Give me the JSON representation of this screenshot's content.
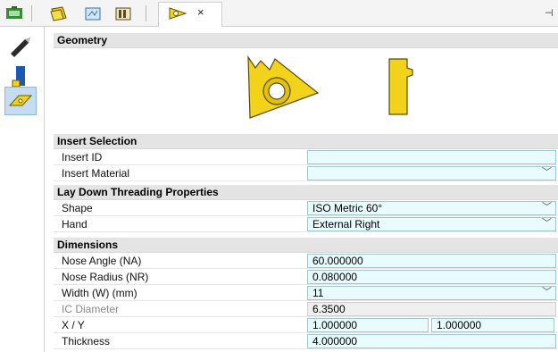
{
  "toolbar": {
    "tabs": [
      {
        "icon": "tool-holder-icon"
      },
      {
        "icon": "insert-stack-icon"
      },
      {
        "icon": "drawing-icon"
      },
      {
        "icon": "library-icon"
      },
      {
        "icon": "threading-insert-icon",
        "active": true
      }
    ],
    "close_label": "×",
    "pin_label": "⊣"
  },
  "leftbar": {
    "items": [
      {
        "icon": "tool-tip-icon"
      },
      {
        "icon": "holder-icon"
      },
      {
        "icon": "insert-icon",
        "active": true
      }
    ]
  },
  "sections": {
    "geometry": {
      "title": "Geometry"
    },
    "insert_selection": {
      "title": "Insert Selection",
      "insert_id": {
        "label": "Insert ID",
        "value": ""
      },
      "insert_material": {
        "label": "Insert Material",
        "value": ""
      }
    },
    "threading": {
      "title": "Lay Down Threading Properties",
      "shape": {
        "label": "Shape",
        "value": "ISO Metric 60°"
      },
      "hand": {
        "label": "Hand",
        "value": "External Right"
      }
    },
    "dimensions": {
      "title": "Dimensions",
      "nose_angle": {
        "label": "Nose Angle (NA)",
        "value": "60.000000"
      },
      "nose_radius": {
        "label": "Nose Radius (NR)",
        "value": "0.080000"
      },
      "width": {
        "label": "Width (W) (mm)",
        "value": "11"
      },
      "ic_diameter": {
        "label": "IC Diameter",
        "value": "6.3500"
      },
      "xy": {
        "label": "X / Y",
        "x": "1.000000",
        "y": "1.000000"
      },
      "thickness": {
        "label": "Thickness",
        "value": "4.000000"
      }
    }
  },
  "colors": {
    "insert_yellow": "#f2d21a",
    "insert_outline": "#6b5a00",
    "field_bg": "#e8fbfd",
    "section_bg": "#e4e4e4"
  }
}
